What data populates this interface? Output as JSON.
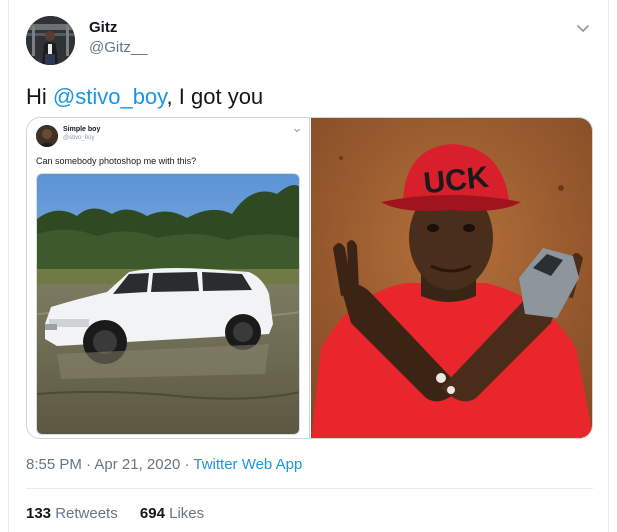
{
  "author": {
    "name": "Gitz",
    "handle": "@Gitz__",
    "avatar_icon": "profile-photo"
  },
  "tweet": {
    "greeting": "Hi ",
    "mention": "@stivo_boy",
    "rest": ", I got you"
  },
  "quoted_screenshot": {
    "name": "Simple boy",
    "handle": "@stivo_boy",
    "text": "Can somebody photoshop me with this?",
    "photo_icon": "white-suv-in-water-photo"
  },
  "photo": {
    "icon": "man-red-cap-toy-car-photo",
    "cap_text": "UCK"
  },
  "meta": {
    "time": "8:55 PM",
    "sep1": " · ",
    "date": "Apr 21, 2020",
    "sep2": " · ",
    "source": "Twitter Web App"
  },
  "stats": {
    "retweets_count": "133",
    "retweets_label": " Retweets",
    "likes_count": "694",
    "likes_label": " Likes"
  },
  "colors": {
    "link": "#1b95e0",
    "secondary": "#657786",
    "border": "#e6ecf0"
  }
}
